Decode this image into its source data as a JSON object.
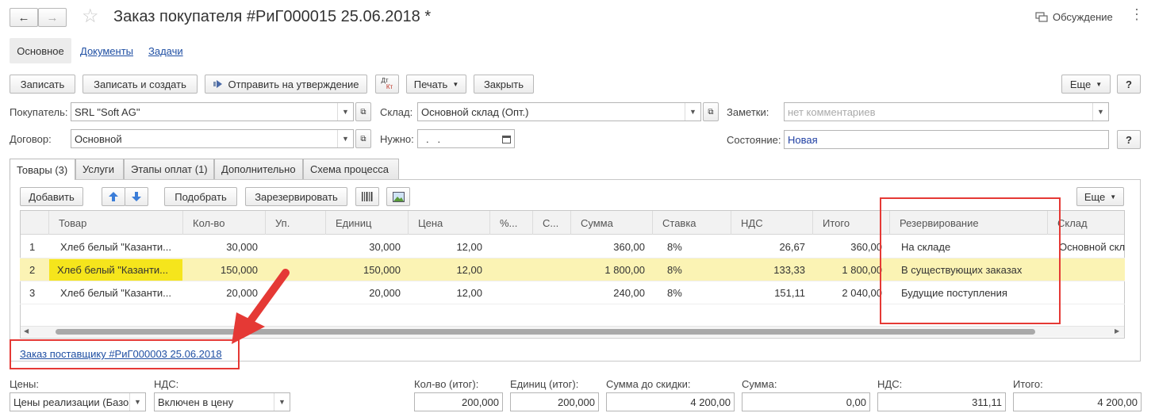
{
  "window": {
    "title": "Заказ покупателя #РиГ000015 25.06.2018 *",
    "discussion_label": "Обсуждение"
  },
  "sections": {
    "main": "Основное",
    "documents": "Документы",
    "tasks": "Задачи"
  },
  "toolbar": {
    "save": "Записать",
    "save_create": "Записать и создать",
    "send_approval": "Отправить на утверждение",
    "dt_kt_top": "Дт",
    "dt_kt_bottom": "Кт",
    "print": "Печать",
    "close": "Закрыть",
    "more": "Еще",
    "help": "?"
  },
  "header_fields": {
    "buyer_label": "Покупатель:",
    "buyer_value": "SRL \"Soft AG\"",
    "contract_label": "Договор:",
    "contract_value": "Основной",
    "warehouse_label": "Склад:",
    "warehouse_value": "Основной склад (Опт.)",
    "need_label": "Нужно:",
    "need_value": ".   .",
    "notes_label": "Заметки:",
    "notes_placeholder": "нет комментариев",
    "state_label": "Состояние:",
    "state_value": "Новая",
    "state_help": "?"
  },
  "tabs": [
    "Товары (3)",
    "Услуги",
    "Этапы оплат (1)",
    "Дополнительно",
    "Схема процесса"
  ],
  "table_toolbar": {
    "add": "Добавить",
    "pick": "Подобрать",
    "reserve": "Зарезервировать",
    "more": "Еще"
  },
  "table": {
    "columns": [
      "",
      "Товар",
      "Кол-во",
      "Уп.",
      "Единиц",
      "Цена",
      "%...",
      "С...",
      "Сумма",
      "Ставка",
      "НДС",
      "Итого",
      "Резервирование",
      "Склад"
    ],
    "rows": [
      {
        "n": "1",
        "item": "Хлеб белый \"Казанти...",
        "qty": "30,000",
        "pack": "",
        "units": "30,000",
        "price": "12,00",
        "pct": "",
        "s": "",
        "sum": "360,00",
        "rate": "8%",
        "vat": "26,67",
        "total": "360,00",
        "reserve": "На складе",
        "warehouse": "Основной скл"
      },
      {
        "n": "2",
        "item": "Хлеб белый \"Казанти...",
        "qty": "150,000",
        "pack": "",
        "units": "150,000",
        "price": "12,00",
        "pct": "",
        "s": "",
        "sum": "1 800,00",
        "rate": "8%",
        "vat": "133,33",
        "total": "1 800,00",
        "reserve": "В существующих заказах",
        "warehouse": ""
      },
      {
        "n": "3",
        "item": "Хлеб белый \"Казанти...",
        "qty": "20,000",
        "pack": "",
        "units": "20,000",
        "price": "12,00",
        "pct": "",
        "s": "",
        "sum": "240,00",
        "rate": "8%",
        "vat": "151,11",
        "total": "2 040,00",
        "reserve": "Будущие поступления",
        "warehouse": ""
      }
    ]
  },
  "supplier_order_link": "Заказ поставщику #РиГ000003 25.06.2018",
  "footer": {
    "prices_label": "Цены:",
    "prices_value": "Цены реализации (Базо",
    "vat_label": "НДС:",
    "vat_value": "Включен в цену",
    "qty_label": "Кол-во (итог):",
    "qty_value": "200,000",
    "units_label": "Единиц (итог):",
    "units_value": "200,000",
    "pre_discount_label": "Сумма до скидки:",
    "pre_discount_value": "4 200,00",
    "sum_label": "Сумма:",
    "sum_value": "0,00",
    "vat_total_label": "НДС:",
    "vat_total_value": "311,11",
    "total_label": "Итого:",
    "total_value": "4 200,00"
  },
  "colors": {
    "accent_selected": "#f5e51c",
    "row_highlight": "#fbf3b4",
    "link": "#1f4fa3",
    "annotation_red": "#e53935"
  }
}
